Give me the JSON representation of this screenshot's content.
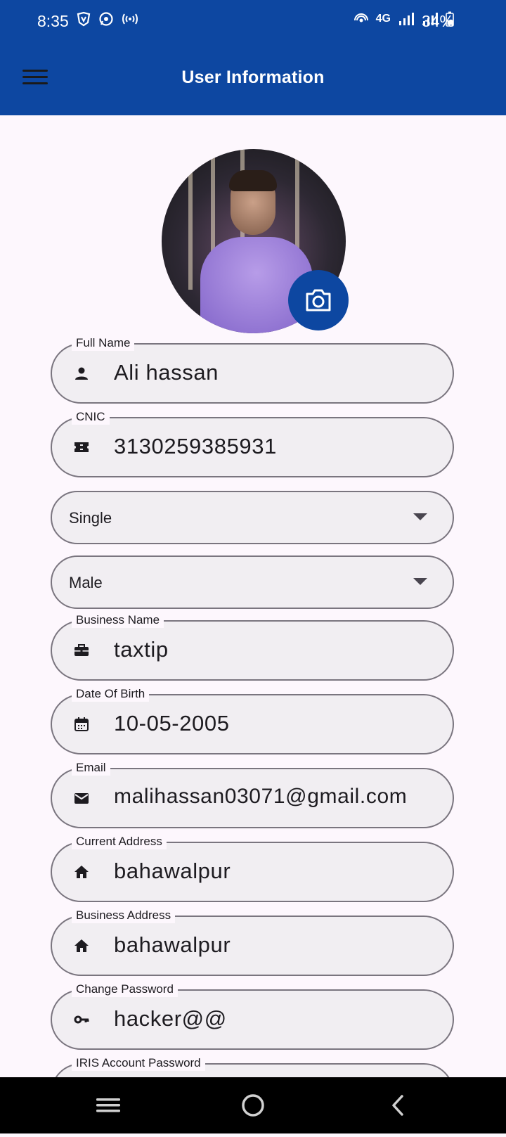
{
  "status_bar": {
    "time": "8:35",
    "network": "4G",
    "battery": "34%"
  },
  "app_bar": {
    "title": "User Information"
  },
  "form": {
    "full_name": {
      "label": "Full Name",
      "value": "Ali hassan"
    },
    "cnic": {
      "label": "CNIC",
      "value": "3130259385931"
    },
    "marital_status": {
      "value": "Single"
    },
    "gender": {
      "value": "Male"
    },
    "business_name": {
      "label": "Business Name",
      "value": "taxtip"
    },
    "dob": {
      "label": "Date Of Birth",
      "value": "10-05-2005"
    },
    "email": {
      "label": "Email",
      "value": "malihassan03071@gmail.com"
    },
    "current_address": {
      "label": "Current Address",
      "value": "bahawalpur"
    },
    "business_address": {
      "label": "Business Address",
      "value": "bahawalpur"
    },
    "change_password": {
      "label": "Change Password",
      "value": "hacker@@"
    },
    "iris_password": {
      "label": "IRIS Account Password",
      "value": ""
    }
  },
  "colors": {
    "primary": "#0d47a1",
    "background": "#fdf7fd",
    "field_fill": "#f1eef2",
    "outline": "#7a757f"
  }
}
